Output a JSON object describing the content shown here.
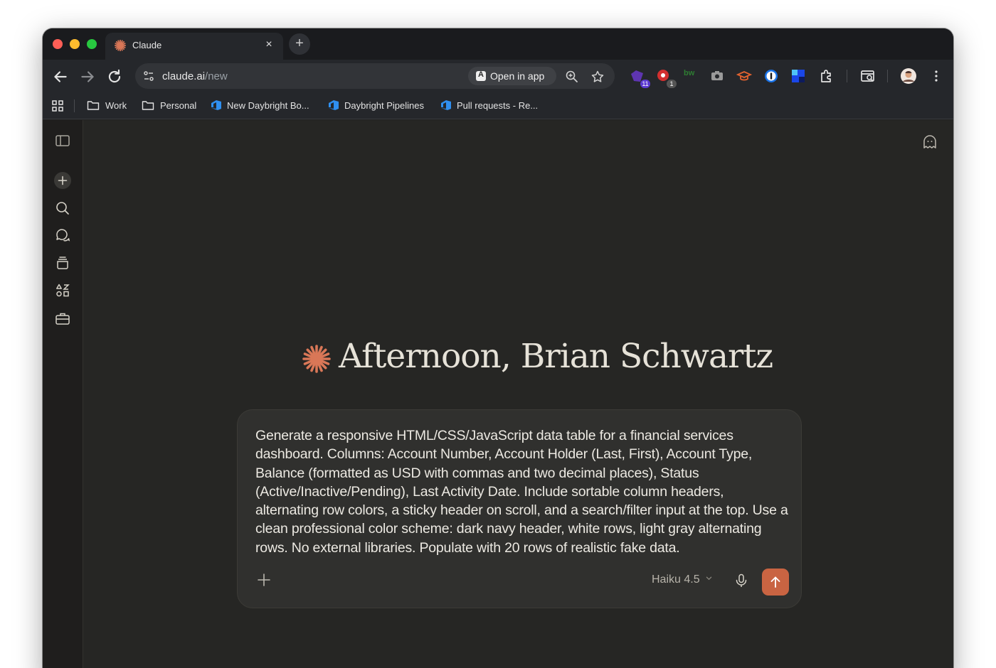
{
  "browser": {
    "tab": {
      "title": "Claude",
      "favicon": "claude-spark-icon",
      "close_glyph": "×"
    },
    "new_tab_glyph": "+",
    "address_bar": {
      "domain": "claude.ai",
      "path": "/new"
    },
    "open_in_app_label": "Open in app",
    "extensions": [
      {
        "name": "purple-extension-icon",
        "badge": "11",
        "color": "#7b3fe4"
      },
      {
        "name": "red-extension-icon",
        "badge": "1",
        "color": "#e53935"
      },
      {
        "name": "bw-extension-icon",
        "text": "bw",
        "color": "#2e7d32"
      },
      {
        "name": "camera-extension-icon"
      },
      {
        "name": "graduation-cap-extension-icon",
        "color": "#e2622f"
      },
      {
        "name": "1password-extension-icon",
        "color": "#1a73e8"
      },
      {
        "name": "blue-square-extension-icon",
        "color": "#1a46e8"
      },
      {
        "name": "puzzle-extensions-icon"
      },
      {
        "name": "tab-search-icon"
      },
      {
        "name": "profile-avatar"
      },
      {
        "name": "kebab-menu-icon"
      }
    ],
    "bookmarks": [
      {
        "label": "Work",
        "icon": "folder-icon"
      },
      {
        "label": "Personal",
        "icon": "folder-icon"
      },
      {
        "label": "New Daybright Bo...",
        "icon": "azure-devops-icon"
      },
      {
        "label": "Daybright Pipelines",
        "icon": "azure-devops-icon"
      },
      {
        "label": "Pull requests - Re...",
        "icon": "azure-devops-icon"
      }
    ]
  },
  "claude": {
    "greeting": "Afternoon, Brian Schwartz",
    "prompt": "Generate a responsive HTML/CSS/JavaScript data table for a financial services dashboard. Columns: Account Number, Account Holder (Last, First), Account Type, Balance (formatted as USD with commas and two decimal places), Status (Active/Inactive/Pending), Last Activity Date. Include sortable column headers, alternating row colors, a sticky header on scroll, and a search/filter input at the top. Use a clean professional color scheme: dark navy header, white rows, light gray alternating rows. No external libraries. Populate with 20 rows of realistic fake data.",
    "model_selector": "Haiku 4.5",
    "accent_color": "#c96442",
    "sidebar_icons": [
      "sidebar-toggle-icon",
      "new-chat-icon",
      "search-icon",
      "chats-icon",
      "projects-icon",
      "artifacts-icon",
      "code-icon"
    ]
  }
}
